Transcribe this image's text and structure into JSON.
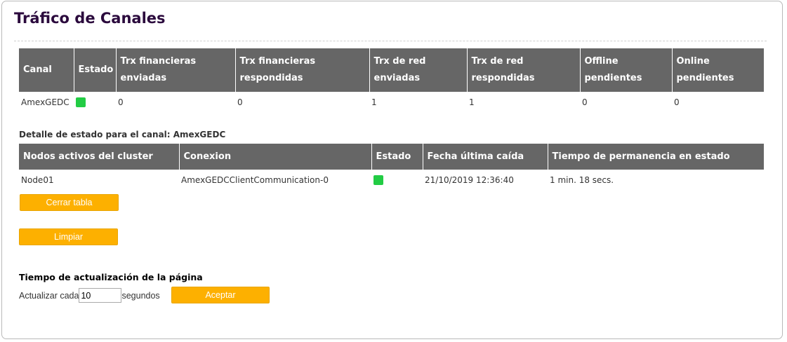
{
  "page": {
    "title": "Tráfico de Canales"
  },
  "channels_table": {
    "headers": {
      "canal": "Canal",
      "estado": "Estado",
      "trx_fin_env_1": "Trx financieras",
      "trx_fin_env_2": "enviadas",
      "trx_fin_resp_1": "Trx financieras",
      "trx_fin_resp_2": "respondidas",
      "trx_red_env_1": "Trx de red",
      "trx_red_env_2": "enviadas",
      "trx_red_resp_1": "Trx de red",
      "trx_red_resp_2": "respondidas",
      "offline_1": "Offline",
      "offline_2": "pendientes",
      "online_1": "Online",
      "online_2": "pendientes"
    },
    "rows": [
      {
        "canal": "AmexGEDC",
        "estado_color": "#22cc44",
        "trx_fin_env": "0",
        "trx_fin_resp": "0",
        "trx_red_env": "1",
        "trx_red_resp": "1",
        "offline_pend": "0",
        "online_pend": "0"
      }
    ]
  },
  "detail": {
    "label": "Detalle de estado para el canal: AmexGEDC",
    "headers": {
      "nodos": "Nodos activos del cluster",
      "conexion": "Conexion",
      "estado": "Estado",
      "fecha": "Fecha última caída",
      "tiempo": "Tiempo de permanencia en estado"
    },
    "rows": [
      {
        "nodo": "Node01",
        "conexion": "AmexGEDCClientCommunication-0",
        "estado_color": "#22cc44",
        "fecha": "21/10/2019 12:36:40",
        "tiempo": "1 min. 18 secs."
      }
    ]
  },
  "buttons": {
    "close_table": "Cerrar tabla",
    "clear": "Limpiar",
    "accept": "Aceptar",
    "color": "#fdb000"
  },
  "refresh": {
    "heading": "Tiempo de actualización de la página",
    "prefix": "Actualizar cada",
    "value": "10",
    "suffix": "segundos"
  },
  "colors": {
    "title": "#2b0a3d",
    "table_header_bg": "#666666",
    "status_ok": "#22cc44"
  }
}
